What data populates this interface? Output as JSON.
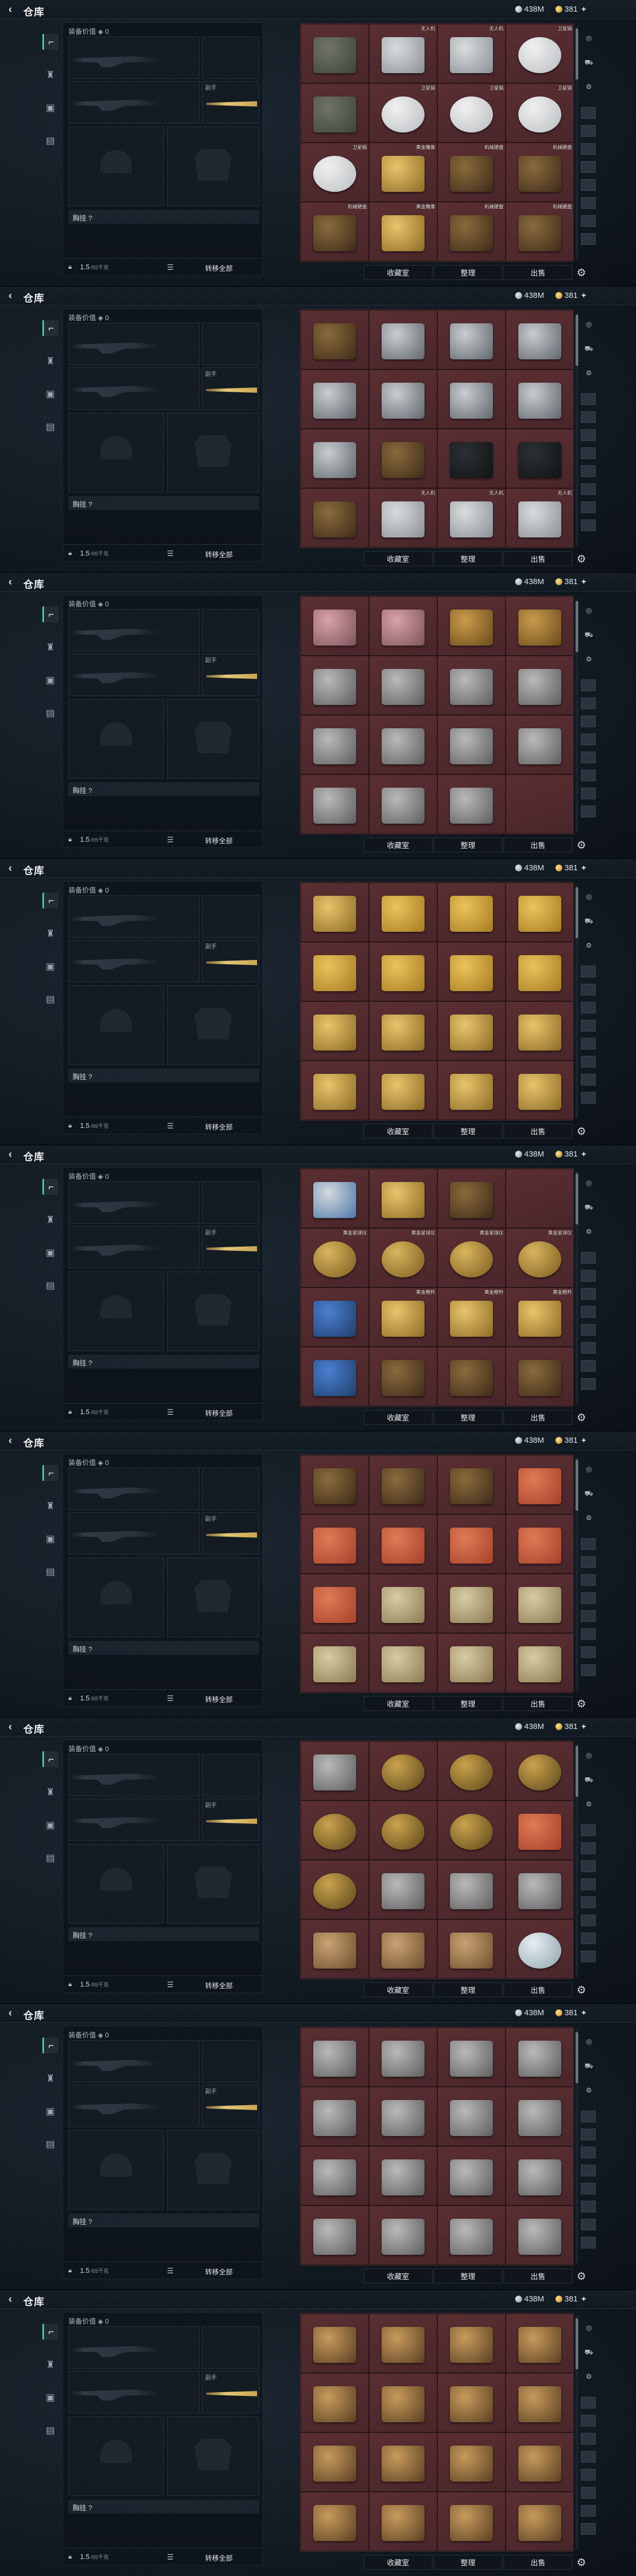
{
  "topbar": {
    "title": "仓库",
    "currency_silver": "438M",
    "currency_gold": "381",
    "back_icon": "chevron-left-icon",
    "plus_icon": "plus-icon"
  },
  "loadout": {
    "equip_value_label": "装备价值",
    "equip_value": "0",
    "pocket_label": "胸挂 ?",
    "weight_value": "1.5",
    "weight_unit": "/65千克",
    "move_all_label": "转移全部",
    "slot_label_weapon": "副手"
  },
  "stash_buttons": {
    "collection": "收藏室",
    "sort": "整理",
    "sell": "出售"
  },
  "left_nav_icons": [
    "pistol-icon",
    "shield-icon",
    "backpack-icon",
    "vest-icon"
  ],
  "right_bar_icons": [
    "target-icon",
    "vehicle-icon",
    "settings-icon"
  ],
  "colors": {
    "accent_green": "#3fd3a0",
    "stash_red": "#3a1d1f",
    "gold": "#e4c776"
  },
  "frames": [
    {
      "items": [
        {
          "l": "",
          "t": "crate"
        },
        {
          "l": "无人机",
          "t": "drone"
        },
        {
          "l": "无人机",
          "t": "drone"
        },
        {
          "l": "卫星锅",
          "t": "dish"
        },
        {
          "l": "",
          "t": "crate"
        },
        {
          "l": "卫星锅",
          "t": "dish"
        },
        {
          "l": "卫星锅",
          "t": "dish"
        },
        {
          "l": "卫星锅",
          "t": "dish"
        },
        {
          "l": "卫星锅",
          "t": "dish"
        },
        {
          "l": "黄金雕像",
          "t": "gold"
        },
        {
          "l": "机械硬盘",
          "t": "box"
        },
        {
          "l": "机械硬盘",
          "t": "box"
        },
        {
          "l": "机械硬盘",
          "t": "box"
        },
        {
          "l": "黄金雕像",
          "t": "gold"
        },
        {
          "l": "机械硬盘",
          "t": "box"
        },
        {
          "l": "机械硬盘",
          "t": "box"
        }
      ]
    },
    {
      "items": [
        {
          "l": "",
          "t": "box"
        },
        {
          "l": "",
          "t": "tv"
        },
        {
          "l": "",
          "t": "tv"
        },
        {
          "l": "",
          "t": "tv"
        },
        {
          "l": "",
          "t": "tv"
        },
        {
          "l": "",
          "t": "tv"
        },
        {
          "l": "",
          "t": "tv"
        },
        {
          "l": "",
          "t": "tv"
        },
        {
          "l": "",
          "t": "tv"
        },
        {
          "l": "",
          "t": "box"
        },
        {
          "l": "",
          "t": "camera"
        },
        {
          "l": "",
          "t": "camera"
        },
        {
          "l": "",
          "t": "box"
        },
        {
          "l": "无人机",
          "t": "drone"
        },
        {
          "l": "无人机",
          "t": "drone"
        },
        {
          "l": "无人机",
          "t": "drone"
        }
      ]
    },
    {
      "items": [
        {
          "l": "",
          "t": "pink"
        },
        {
          "l": "",
          "t": "pink"
        },
        {
          "l": "",
          "t": "key"
        },
        {
          "l": "",
          "t": "key"
        },
        {
          "l": "",
          "t": "small"
        },
        {
          "l": "",
          "t": "small"
        },
        {
          "l": "",
          "t": "small"
        },
        {
          "l": "",
          "t": "small"
        },
        {
          "l": "",
          "t": "small"
        },
        {
          "l": "",
          "t": "small"
        },
        {
          "l": "",
          "t": "small"
        },
        {
          "l": "",
          "t": "small"
        },
        {
          "l": "",
          "t": "small"
        },
        {
          "l": "",
          "t": "small"
        },
        {
          "l": "",
          "t": "small"
        },
        {
          "l": "",
          "t": "empty"
        }
      ]
    },
    {
      "items": [
        {
          "l": "",
          "t": "gold"
        },
        {
          "l": "",
          "t": "goldbar"
        },
        {
          "l": "",
          "t": "goldbar"
        },
        {
          "l": "",
          "t": "goldbar"
        },
        {
          "l": "",
          "t": "goldbar"
        },
        {
          "l": "",
          "t": "goldbar"
        },
        {
          "l": "",
          "t": "goldbar"
        },
        {
          "l": "",
          "t": "goldbar"
        },
        {
          "l": "",
          "t": "gold"
        },
        {
          "l": "",
          "t": "gold"
        },
        {
          "l": "",
          "t": "gold"
        },
        {
          "l": "",
          "t": "gold"
        },
        {
          "l": "",
          "t": "gold"
        },
        {
          "l": "",
          "t": "gold"
        },
        {
          "l": "",
          "t": "gold"
        },
        {
          "l": "",
          "t": "gold"
        }
      ]
    },
    {
      "items": [
        {
          "l": "",
          "t": "laptop"
        },
        {
          "l": "",
          "t": "gold"
        },
        {
          "l": "",
          "t": "box"
        },
        {
          "l": "",
          "t": "empty"
        },
        {
          "l": "黄金星球仪",
          "t": "globe"
        },
        {
          "l": "黄金星球仪",
          "t": "globe"
        },
        {
          "l": "黄金星球仪",
          "t": "globe"
        },
        {
          "l": "黄金星球仪",
          "t": "globe"
        },
        {
          "l": "",
          "t": "blue"
        },
        {
          "l": "黄金瞪羚",
          "t": "gold"
        },
        {
          "l": "黄金瞪羚",
          "t": "gold"
        },
        {
          "l": "黄金瞪羚",
          "t": "gold"
        },
        {
          "l": "",
          "t": "blue"
        },
        {
          "l": "",
          "t": "box"
        },
        {
          "l": "",
          "t": "box"
        },
        {
          "l": "",
          "t": "box"
        }
      ]
    },
    {
      "items": [
        {
          "l": "",
          "t": "box"
        },
        {
          "l": "",
          "t": "box"
        },
        {
          "l": "",
          "t": "box"
        },
        {
          "l": "",
          "t": "fish"
        },
        {
          "l": "",
          "t": "fish"
        },
        {
          "l": "",
          "t": "fish"
        },
        {
          "l": "",
          "t": "fish"
        },
        {
          "l": "",
          "t": "fish"
        },
        {
          "l": "",
          "t": "fish"
        },
        {
          "l": "",
          "t": "scroll"
        },
        {
          "l": "",
          "t": "scroll"
        },
        {
          "l": "",
          "t": "scroll"
        },
        {
          "l": "",
          "t": "scroll"
        },
        {
          "l": "",
          "t": "scroll"
        },
        {
          "l": "",
          "t": "scroll"
        },
        {
          "l": "",
          "t": "scroll"
        }
      ]
    },
    {
      "items": [
        {
          "l": "",
          "t": "small"
        },
        {
          "l": "",
          "t": "disc"
        },
        {
          "l": "",
          "t": "disc"
        },
        {
          "l": "",
          "t": "disc"
        },
        {
          "l": "",
          "t": "disc"
        },
        {
          "l": "",
          "t": "disc"
        },
        {
          "l": "",
          "t": "disc"
        },
        {
          "l": "",
          "t": "fish"
        },
        {
          "l": "",
          "t": "disc"
        },
        {
          "l": "",
          "t": "small"
        },
        {
          "l": "",
          "t": "small"
        },
        {
          "l": "",
          "t": "small"
        },
        {
          "l": "",
          "t": "hand"
        },
        {
          "l": "",
          "t": "hand"
        },
        {
          "l": "",
          "t": "hand"
        },
        {
          "l": "",
          "t": "orb"
        }
      ]
    },
    {
      "items": [
        {
          "l": "",
          "t": "small"
        },
        {
          "l": "",
          "t": "small"
        },
        {
          "l": "",
          "t": "small"
        },
        {
          "l": "",
          "t": "small"
        },
        {
          "l": "",
          "t": "small"
        },
        {
          "l": "",
          "t": "small"
        },
        {
          "l": "",
          "t": "small"
        },
        {
          "l": "",
          "t": "small"
        },
        {
          "l": "",
          "t": "small"
        },
        {
          "l": "",
          "t": "small"
        },
        {
          "l": "",
          "t": "small"
        },
        {
          "l": "",
          "t": "small"
        },
        {
          "l": "",
          "t": "small"
        },
        {
          "l": "",
          "t": "small"
        },
        {
          "l": "",
          "t": "small"
        },
        {
          "l": "",
          "t": "small"
        }
      ]
    },
    {
      "items": [
        {
          "l": "",
          "t": "ammo"
        },
        {
          "l": "",
          "t": "ammo"
        },
        {
          "l": "",
          "t": "ammo"
        },
        {
          "l": "",
          "t": "ammo"
        },
        {
          "l": "",
          "t": "ammo"
        },
        {
          "l": "",
          "t": "ammo"
        },
        {
          "l": "",
          "t": "ammo"
        },
        {
          "l": "",
          "t": "ammo"
        },
        {
          "l": "",
          "t": "ammo"
        },
        {
          "l": "",
          "t": "ammo"
        },
        {
          "l": "",
          "t": "ammo"
        },
        {
          "l": "",
          "t": "ammo"
        },
        {
          "l": "",
          "t": "ammo"
        },
        {
          "l": "",
          "t": "ammo"
        },
        {
          "l": "",
          "t": "ammo"
        },
        {
          "l": "",
          "t": "ammo"
        }
      ]
    }
  ]
}
